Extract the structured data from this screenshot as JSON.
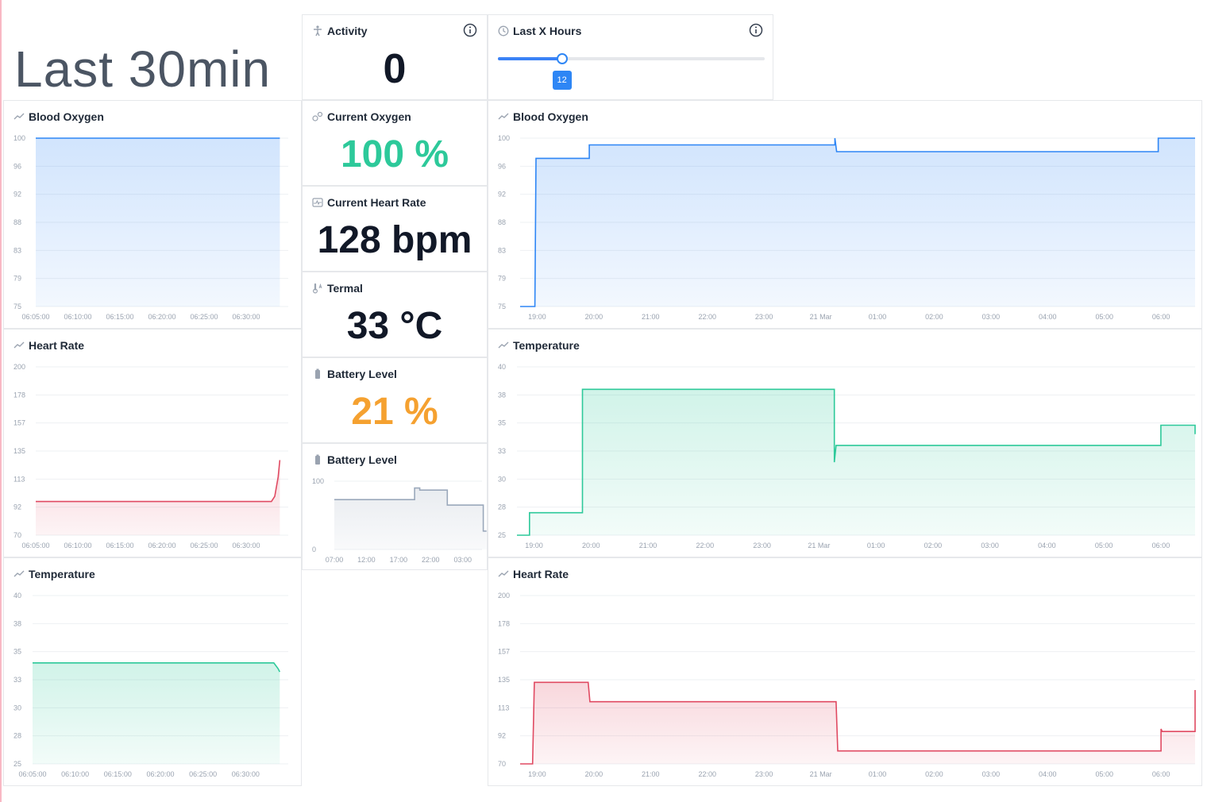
{
  "colors": {
    "blue": "#2e86f5",
    "green": "#2dc99a",
    "red": "#e04a62",
    "orange": "#f5a130",
    "gray": "#9aa8bb",
    "dark": "#111827"
  },
  "header": {
    "last30_label": "Last 30min",
    "activity": {
      "title": "Activity",
      "icon": "person-icon",
      "value": "0"
    },
    "lastx": {
      "title": "Last X Hours",
      "icon": "clock-icon",
      "slider_value": "12",
      "slider_fraction": 0.24
    }
  },
  "stats": {
    "current_oxygen": {
      "title": "Current Oxygen",
      "icon": "oxygen-icon",
      "value": "100 %"
    },
    "current_heart_rate": {
      "title": "Current Heart Rate",
      "icon": "heart-monitor-icon",
      "value": "128 bpm"
    },
    "termal": {
      "title": "Termal",
      "icon": "thermometer-icon",
      "value": "33 °C"
    },
    "battery_level": {
      "title": "Battery Level",
      "icon": "battery-icon",
      "value": "21 %"
    },
    "battery_chart_title": "Battery Level"
  },
  "chart_data": [
    {
      "id": "blood-oxygen-30",
      "title": "Blood Oxygen",
      "type": "area",
      "color": "#2e86f5",
      "y_ticks": [
        "100",
        "96",
        "92",
        "88",
        "83",
        "79",
        "75"
      ],
      "ylim": [
        75,
        100
      ],
      "x_ticks": [
        "06:05:00",
        "06:10:00",
        "06:15:00",
        "06:20:00",
        "06:25:00",
        "06:30:00"
      ],
      "xlim": [
        0,
        30
      ],
      "x_tick_positions": [
        0,
        5,
        10,
        15,
        20,
        25
      ],
      "points": [
        [
          0,
          100
        ],
        [
          29,
          100
        ]
      ]
    },
    {
      "id": "heart-rate-30",
      "title": "Heart Rate",
      "type": "area",
      "color": "#e04a62",
      "y_ticks": [
        "200",
        "178",
        "157",
        "135",
        "113",
        "92",
        "70"
      ],
      "ylim": [
        70,
        200
      ],
      "x_ticks": [
        "06:05:00",
        "06:10:00",
        "06:15:00",
        "06:20:00",
        "06:25:00",
        "06:30:00"
      ],
      "xlim": [
        0,
        30
      ],
      "x_tick_positions": [
        0,
        5,
        10,
        15,
        20,
        25
      ],
      "points": [
        [
          0,
          96
        ],
        [
          28,
          96
        ],
        [
          28.4,
          100
        ],
        [
          28.8,
          115
        ],
        [
          29,
          128
        ]
      ]
    },
    {
      "id": "temperature-30",
      "title": "Temperature",
      "type": "area",
      "color": "#2dc99a",
      "y_ticks": [
        "40",
        "38",
        "35",
        "33",
        "30",
        "28",
        "25"
      ],
      "ylim": [
        25,
        40
      ],
      "x_ticks": [
        "06:05:00",
        "06:10:00",
        "06:15:00",
        "06:20:00",
        "06:25:00",
        "06:30:00"
      ],
      "xlim": [
        0,
        30
      ],
      "x_tick_positions": [
        0,
        5,
        10,
        15,
        20,
        25
      ],
      "points": [
        [
          0,
          34
        ],
        [
          28.3,
          34
        ],
        [
          28.8,
          33.5
        ],
        [
          29,
          33.2
        ]
      ]
    },
    {
      "id": "battery",
      "title": "Battery Level",
      "type": "area",
      "color": "#9aa8bb",
      "y_ticks": [
        "100",
        "0"
      ],
      "ylim": [
        0,
        100
      ],
      "x_ticks": [
        "07:00",
        "12:00",
        "17:00",
        "22:00",
        "03:00"
      ],
      "xlim": [
        0,
        23
      ],
      "x_tick_positions": [
        0,
        5,
        10,
        15,
        20
      ],
      "points": [
        [
          0,
          73
        ],
        [
          12.5,
          73
        ],
        [
          12.5,
          90
        ],
        [
          13.3,
          90
        ],
        [
          13.3,
          87
        ],
        [
          17.6,
          87
        ],
        [
          17.6,
          65
        ],
        [
          23.2,
          65
        ],
        [
          23.2,
          27
        ],
        [
          23.7,
          27
        ]
      ]
    },
    {
      "id": "blood-oxygen-12h",
      "title": "Blood Oxygen",
      "type": "area",
      "color": "#2e86f5",
      "y_ticks": [
        "100",
        "96",
        "92",
        "88",
        "83",
        "79",
        "75"
      ],
      "ylim": [
        75,
        100
      ],
      "x_ticks": [
        "19:00",
        "20:00",
        "21:00",
        "22:00",
        "23:00",
        "21 Mar",
        "01:00",
        "02:00",
        "03:00",
        "04:00",
        "05:00",
        "06:00"
      ],
      "xlim": [
        18.7,
        30.6
      ],
      "x_tick_positions": [
        19,
        20,
        21,
        22,
        23,
        24,
        25,
        26,
        27,
        28,
        29,
        30
      ],
      "points": [
        [
          18.7,
          75
        ],
        [
          18.96,
          75
        ],
        [
          18.98,
          97
        ],
        [
          19.92,
          97
        ],
        [
          19.92,
          99
        ],
        [
          24.25,
          99
        ],
        [
          24.25,
          100
        ],
        [
          24.28,
          98
        ],
        [
          29.95,
          98
        ],
        [
          29.95,
          100
        ],
        [
          30.6,
          100
        ]
      ]
    },
    {
      "id": "temperature-12h",
      "title": "Temperature",
      "type": "area",
      "color": "#2dc99a",
      "y_ticks": [
        "40",
        "38",
        "35",
        "33",
        "30",
        "28",
        "25"
      ],
      "ylim": [
        25,
        40
      ],
      "x_ticks": [
        "19:00",
        "20:00",
        "21:00",
        "22:00",
        "23:00",
        "21 Mar",
        "01:00",
        "02:00",
        "03:00",
        "04:00",
        "05:00",
        "06:00"
      ],
      "xlim": [
        18.7,
        30.6
      ],
      "x_tick_positions": [
        19,
        20,
        21,
        22,
        23,
        24,
        25,
        26,
        27,
        28,
        29,
        30
      ],
      "points": [
        [
          18.7,
          25
        ],
        [
          18.92,
          25
        ],
        [
          18.92,
          27
        ],
        [
          19.85,
          27
        ],
        [
          19.85,
          38
        ],
        [
          24.27,
          38
        ],
        [
          24.27,
          31.5
        ],
        [
          24.3,
          33
        ],
        [
          30,
          33
        ],
        [
          30,
          34.8
        ],
        [
          30.6,
          34.8
        ],
        [
          30.6,
          34
        ]
      ]
    },
    {
      "id": "heart-rate-12h",
      "title": "Heart Rate",
      "type": "area",
      "color": "#e04a62",
      "y_ticks": [
        "200",
        "178",
        "157",
        "135",
        "113",
        "92",
        "70"
      ],
      "ylim": [
        70,
        200
      ],
      "x_ticks": [
        "19:00",
        "20:00",
        "21:00",
        "22:00",
        "23:00",
        "21 Mar",
        "01:00",
        "02:00",
        "03:00",
        "04:00",
        "05:00",
        "06:00"
      ],
      "xlim": [
        18.7,
        30.6
      ],
      "x_tick_positions": [
        19,
        20,
        21,
        22,
        23,
        24,
        25,
        26,
        27,
        28,
        29,
        30
      ],
      "points": [
        [
          18.7,
          70
        ],
        [
          18.92,
          70
        ],
        [
          18.95,
          133
        ],
        [
          19.9,
          133
        ],
        [
          19.93,
          118
        ],
        [
          24.27,
          118
        ],
        [
          24.3,
          80
        ],
        [
          30,
          80
        ],
        [
          30,
          97
        ],
        [
          30.02,
          95
        ],
        [
          30.6,
          95
        ],
        [
          30.6,
          127
        ]
      ]
    }
  ]
}
